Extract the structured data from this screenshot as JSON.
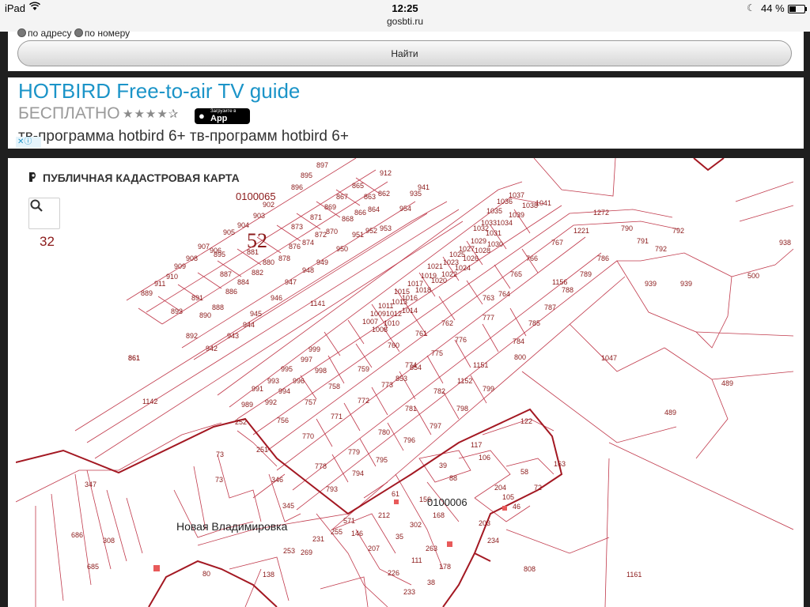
{
  "status_bar": {
    "device": "iPad",
    "time": "12:25",
    "url": "gosbti.ru",
    "battery": "44 %",
    "battery_level": 0.44
  },
  "search_form": {
    "option_address": "по адресу",
    "option_number": "по номеру",
    "find_button": "Найти"
  },
  "ad": {
    "title": "HOTBIRD Free-to-air TV guide",
    "price": "БЕСПЛАТНО",
    "rating_stars": "★★★★✰",
    "store_small": "Загрузите в",
    "store_big": "App Store",
    "description": "тв-программа hotbird 6+ тв-программ hotbird 6+",
    "badge": "✕ⓘ"
  },
  "map": {
    "title": "ПУБЛИЧНАЯ КАДАСТРОВАЯ КАРТА",
    "zoom_level": "32",
    "quarter_top": "0100065",
    "quarter_number": "52",
    "quarter_bottom": "0100006",
    "place_name": "Новая Владимировка",
    "colors": {
      "parcel_line": "#c0394b",
      "quarter_line": "#a31822",
      "label": "#8b1a1a"
    },
    "parcel_labels": [
      [
        "897",
        380,
        12
      ],
      [
        "895",
        360,
        25
      ],
      [
        "896",
        348,
        40
      ],
      [
        "912",
        460,
        22
      ],
      [
        "941",
        508,
        40
      ],
      [
        "935",
        498,
        48
      ],
      [
        "865",
        425,
        38
      ],
      [
        "863",
        440,
        52
      ],
      [
        "862",
        458,
        48
      ],
      [
        "867",
        405,
        52
      ],
      [
        "869",
        390,
        65
      ],
      [
        "871",
        372,
        78
      ],
      [
        "868",
        412,
        80
      ],
      [
        "866",
        428,
        72
      ],
      [
        "864",
        445,
        68
      ],
      [
        "954",
        485,
        67
      ],
      [
        "953",
        460,
        92
      ],
      [
        "952",
        442,
        95
      ],
      [
        "903",
        300,
        76
      ],
      [
        "902",
        312,
        62
      ],
      [
        "873",
        348,
        90
      ],
      [
        "870",
        392,
        96
      ],
      [
        "872",
        378,
        100
      ],
      [
        "874",
        362,
        110
      ],
      [
        "876",
        345,
        115
      ],
      [
        "878",
        332,
        130
      ],
      [
        "880",
        312,
        135
      ],
      [
        "881",
        292,
        122
      ],
      [
        "882",
        298,
        148
      ],
      [
        "884",
        280,
        160
      ],
      [
        "886",
        265,
        172
      ],
      [
        "887",
        258,
        150
      ],
      [
        "888",
        248,
        192
      ],
      [
        "890",
        232,
        202
      ],
      [
        "891",
        222,
        180
      ],
      [
        "893",
        196,
        197
      ],
      [
        "892",
        215,
        228
      ],
      [
        "895",
        250,
        125
      ],
      [
        "904",
        280,
        88
      ],
      [
        "905",
        262,
        97
      ],
      [
        "906",
        245,
        120
      ],
      [
        "907",
        230,
        115
      ],
      [
        "908",
        215,
        130
      ],
      [
        "909",
        200,
        140
      ],
      [
        "910",
        190,
        153
      ],
      [
        "911",
        175,
        162
      ],
      [
        "889",
        158,
        174
      ],
      [
        "950",
        405,
        118
      ],
      [
        "951",
        425,
        100
      ],
      [
        "949",
        380,
        135
      ],
      [
        "948",
        362,
        145
      ],
      [
        "947",
        340,
        160
      ],
      [
        "946",
        322,
        180
      ],
      [
        "945",
        296,
        200
      ],
      [
        "944",
        287,
        214
      ],
      [
        "943",
        267,
        228
      ],
      [
        "942",
        240,
        244
      ],
      [
        "1141",
        372,
        187
      ],
      [
        "861",
        142,
        256
      ],
      [
        "1142",
        160,
        311
      ],
      [
        "1037",
        623,
        50
      ],
      [
        "1038",
        640,
        63
      ],
      [
        "1041",
        657,
        60
      ],
      [
        "1036",
        608,
        58
      ],
      [
        "1039",
        623,
        75
      ],
      [
        "1035",
        595,
        70
      ],
      [
        "1034",
        608,
        85
      ],
      [
        "1033",
        588,
        85
      ],
      [
        "1032",
        578,
        92
      ],
      [
        "1031",
        594,
        98
      ],
      [
        "1030",
        596,
        112
      ],
      [
        "1029",
        575,
        108
      ],
      [
        "1028",
        580,
        120
      ],
      [
        "1027",
        560,
        118
      ],
      [
        "1026",
        565,
        130
      ],
      [
        "1025",
        548,
        125
      ],
      [
        "1024",
        555,
        142
      ],
      [
        "1023",
        540,
        135
      ],
      [
        "1022",
        538,
        150
      ],
      [
        "1021",
        520,
        140
      ],
      [
        "1020",
        525,
        158
      ],
      [
        "1019",
        512,
        152
      ],
      [
        "1018",
        505,
        170
      ],
      [
        "1017",
        495,
        162
      ],
      [
        "1016",
        488,
        180
      ],
      [
        "1015",
        478,
        172
      ],
      [
        "1014",
        488,
        196
      ],
      [
        "1013",
        475,
        185
      ],
      [
        "1012",
        468,
        200
      ],
      [
        "1011",
        458,
        190
      ],
      [
        "1010",
        465,
        212
      ],
      [
        "1009",
        448,
        200
      ],
      [
        "1008",
        450,
        220
      ],
      [
        "1007",
        438,
        210
      ],
      [
        "1272",
        730,
        72
      ],
      [
        "1221",
        705,
        95
      ],
      [
        "790",
        765,
        92
      ],
      [
        "791",
        785,
        108
      ],
      [
        "792",
        808,
        118
      ],
      [
        "792",
        830,
        95
      ],
      [
        "767",
        677,
        110
      ],
      [
        "766",
        645,
        130
      ],
      [
        "765",
        625,
        150
      ],
      [
        "764",
        610,
        175
      ],
      [
        "763",
        590,
        180
      ],
      [
        "786",
        735,
        130
      ],
      [
        "789",
        713,
        150
      ],
      [
        "788",
        690,
        170
      ],
      [
        "1156",
        678,
        160
      ],
      [
        "787",
        668,
        192
      ],
      [
        "785",
        648,
        212
      ],
      [
        "784",
        628,
        235
      ],
      [
        "800",
        630,
        255
      ],
      [
        "777",
        590,
        205
      ],
      [
        "776",
        555,
        233
      ],
      [
        "775",
        525,
        250
      ],
      [
        "774",
        492,
        265
      ],
      [
        "773",
        462,
        290
      ],
      [
        "772",
        432,
        310
      ],
      [
        "771",
        398,
        330
      ],
      [
        "770",
        362,
        355
      ],
      [
        "762",
        538,
        212
      ],
      [
        "761",
        505,
        225
      ],
      [
        "760",
        470,
        240
      ],
      [
        "759",
        432,
        270
      ],
      [
        "758",
        395,
        292
      ],
      [
        "757",
        365,
        312
      ],
      [
        "756",
        330,
        335
      ],
      [
        "999",
        370,
        245
      ],
      [
        "998",
        378,
        272
      ],
      [
        "997",
        360,
        258
      ],
      [
        "996",
        350,
        285
      ],
      [
        "995",
        335,
        270
      ],
      [
        "994",
        332,
        298
      ],
      [
        "993",
        318,
        285
      ],
      [
        "992",
        315,
        312
      ],
      [
        "991",
        298,
        295
      ],
      [
        "989",
        285,
        315
      ],
      [
        "854",
        498,
        268
      ],
      [
        "853",
        480,
        282
      ],
      [
        "1151",
        578,
        265
      ],
      [
        "1152",
        558,
        285
      ],
      [
        "782",
        528,
        298
      ],
      [
        "781",
        492,
        320
      ],
      [
        "780",
        458,
        350
      ],
      [
        "779",
        420,
        375
      ],
      [
        "778",
        378,
        393
      ],
      [
        "799",
        590,
        295
      ],
      [
        "798",
        557,
        320
      ],
      [
        "797",
        523,
        342
      ],
      [
        "796",
        490,
        360
      ],
      [
        "795",
        455,
        385
      ],
      [
        "794",
        425,
        402
      ],
      [
        "793",
        392,
        422
      ],
      [
        "1047",
        740,
        256
      ],
      [
        "939",
        795,
        162
      ],
      [
        "939",
        840,
        162
      ],
      [
        "938",
        965,
        110
      ],
      [
        "500",
        925,
        152
      ],
      [
        "489",
        892,
        288
      ],
      [
        "489",
        820,
        325
      ],
      [
        "861",
        142,
        256
      ],
      [
        "122",
        638,
        336
      ],
      [
        "117",
        575,
        366
      ],
      [
        "106",
        585,
        382
      ],
      [
        "39",
        535,
        392
      ],
      [
        "88",
        548,
        408
      ],
      [
        "163",
        680,
        390
      ],
      [
        "58",
        638,
        400
      ],
      [
        "72",
        655,
        420
      ],
      [
        "204",
        605,
        420
      ],
      [
        "105",
        615,
        432
      ],
      [
        "46",
        628,
        444
      ],
      [
        "156",
        510,
        435
      ],
      [
        "168",
        527,
        455
      ],
      [
        "203",
        585,
        465
      ],
      [
        "234",
        596,
        487
      ],
      [
        "61",
        475,
        428
      ],
      [
        "212",
        458,
        455
      ],
      [
        "302",
        498,
        467
      ],
      [
        "35",
        480,
        482
      ],
      [
        "263",
        518,
        497
      ],
      [
        "111",
        500,
        512
      ],
      [
        "178",
        535,
        520
      ],
      [
        "207",
        445,
        497
      ],
      [
        "226",
        470,
        528
      ],
      [
        "233",
        490,
        552
      ],
      [
        "38",
        520,
        540
      ],
      [
        "80",
        236,
        529
      ],
      [
        "138",
        312,
        530
      ],
      [
        "231",
        375,
        485
      ],
      [
        "146",
        424,
        478
      ],
      [
        "571",
        414,
        462
      ],
      [
        "255",
        398,
        476
      ],
      [
        "253",
        338,
        500
      ],
      [
        "269",
        360,
        502
      ],
      [
        "251",
        304,
        372
      ],
      [
        "252",
        277,
        337
      ],
      [
        "73",
        252,
        410
      ],
      [
        "346",
        323,
        410
      ],
      [
        "345",
        337,
        443
      ],
      [
        "808",
        642,
        523
      ],
      [
        "1161",
        772,
        530
      ],
      [
        "347",
        87,
        416
      ],
      [
        "308",
        110,
        487
      ],
      [
        "685",
        90,
        520
      ],
      [
        "686",
        70,
        480
      ],
      [
        "73",
        253,
        378
      ]
    ]
  }
}
